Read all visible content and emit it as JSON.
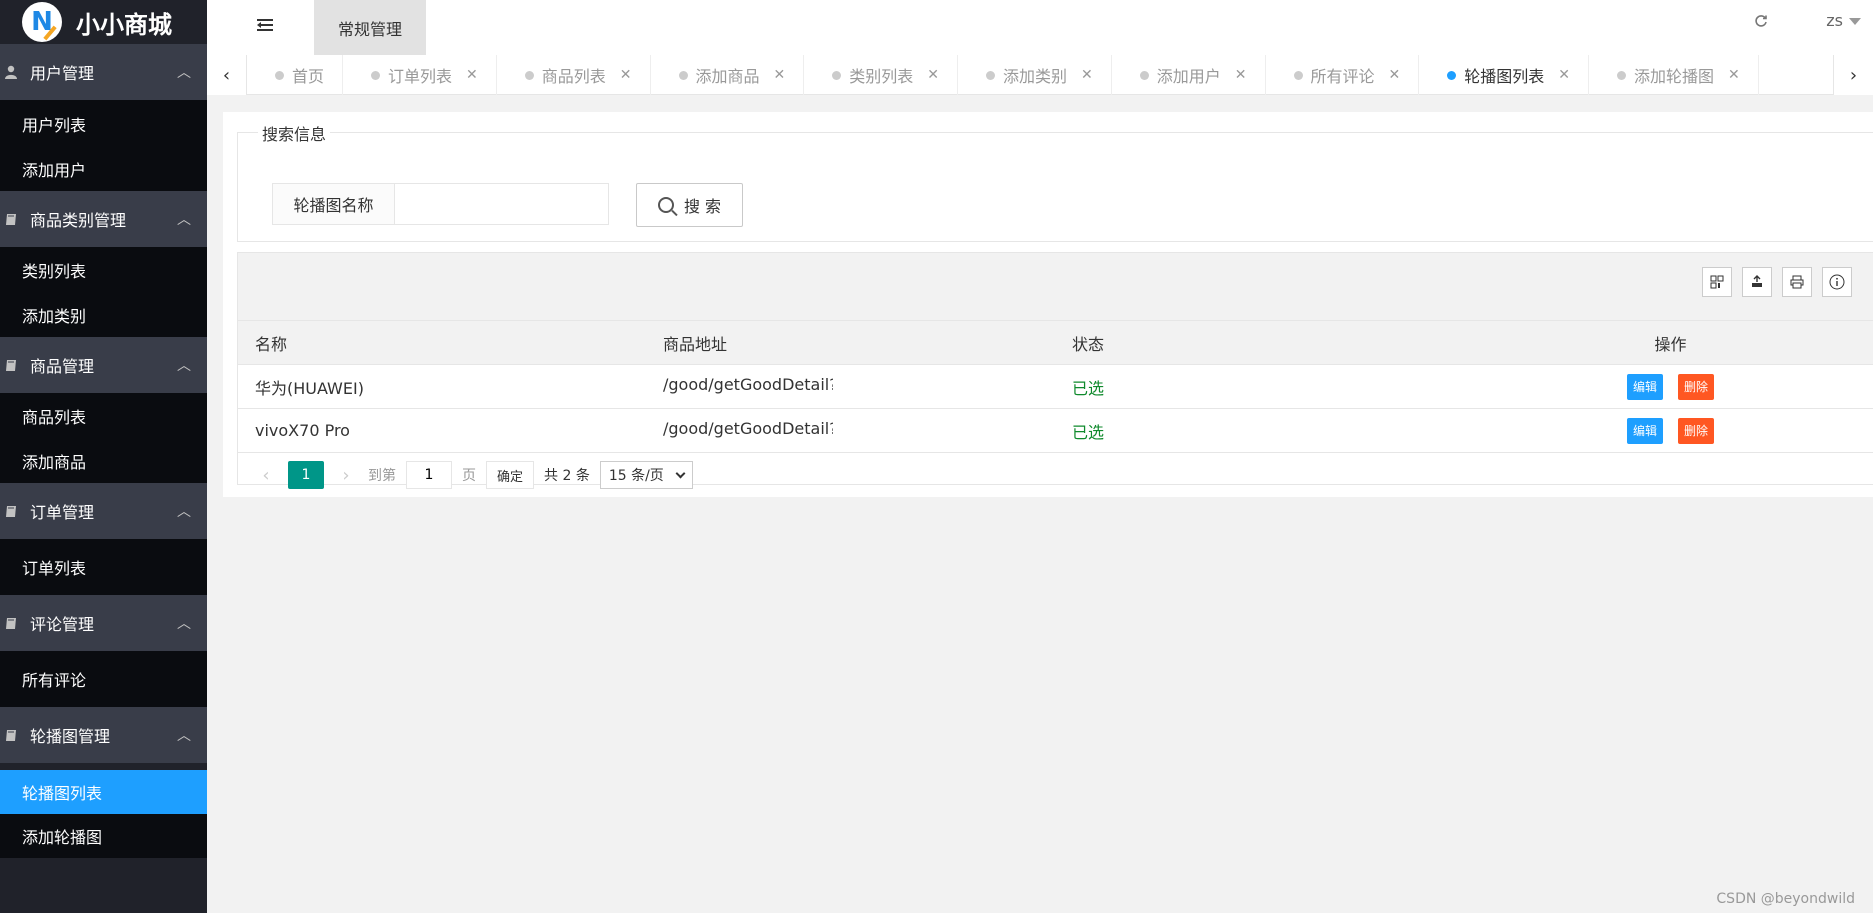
{
  "app": {
    "logo_text": "小小商城",
    "logo_letter": "N"
  },
  "header": {
    "top_tab": "常规管理",
    "user": "zs"
  },
  "sidebar": {
    "groups": [
      {
        "label": "用户管理",
        "items": [
          {
            "label": "用户列表"
          },
          {
            "label": "添加用户"
          }
        ]
      },
      {
        "label": "商品类别管理",
        "items": [
          {
            "label": "类别列表"
          },
          {
            "label": "添加类别"
          }
        ]
      },
      {
        "label": "商品管理",
        "items": [
          {
            "label": "商品列表"
          },
          {
            "label": "添加商品"
          }
        ]
      },
      {
        "label": "订单管理",
        "items": [
          {
            "label": "订单列表"
          }
        ]
      },
      {
        "label": "评论管理",
        "items": [
          {
            "label": "所有评论"
          }
        ]
      },
      {
        "label": "轮播图管理",
        "items": [
          {
            "label": "轮播图列表"
          },
          {
            "label": "添加轮播图"
          }
        ]
      }
    ]
  },
  "tabs": [
    {
      "label": "首页",
      "closable": false
    },
    {
      "label": "订单列表",
      "closable": true
    },
    {
      "label": "商品列表",
      "closable": true
    },
    {
      "label": "添加商品",
      "closable": true
    },
    {
      "label": "类别列表",
      "closable": true
    },
    {
      "label": "添加类别",
      "closable": true
    },
    {
      "label": "添加用户",
      "closable": true
    },
    {
      "label": "所有评论",
      "closable": true
    },
    {
      "label": "轮播图列表",
      "closable": true,
      "active": true
    },
    {
      "label": "添加轮播图",
      "closable": true
    }
  ],
  "search": {
    "legend": "搜索信息",
    "field_label": "轮播图名称",
    "field_value": "",
    "button_label": "搜 索"
  },
  "table": {
    "columns": [
      "名称",
      "商品地址",
      "状态",
      "操作"
    ],
    "rows": [
      {
        "name": "华为(HUAWEI)",
        "url": "/good/getGoodDetail?goodId=",
        "status": "已选"
      },
      {
        "name": "vivoX70 Pro",
        "url": "/good/getGoodDetail?goodId=",
        "status": "已选"
      }
    ],
    "edit_label": "编辑",
    "delete_label": "删除"
  },
  "pager": {
    "current": "1",
    "goto_label": "到第",
    "goto_value": "1",
    "page_label": "页",
    "ok_label": "确定",
    "count_label": "共 2 条",
    "page_size": "15 条/页"
  },
  "watermark": "CSDN @beyondwild",
  "colors": {
    "sidebar_bg": "#20222a",
    "active_blue": "#1e9fff",
    "pager_green": "#009688",
    "delete_orange": "#ff5722"
  }
}
